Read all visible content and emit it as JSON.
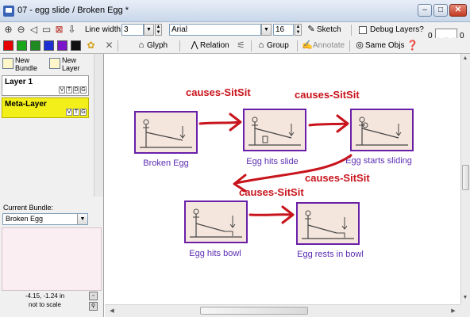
{
  "window": {
    "title": "07 - egg slide / Broken Egg *",
    "buttons": {
      "minimize": "–",
      "maximize": "□",
      "close": "✕"
    }
  },
  "toolbar1": {
    "line_width_label": "Line width:",
    "line_width_value": "3",
    "font_value": "Arial",
    "font_size_value": "16",
    "sketch_label": "Sketch",
    "debug_layers_label": "Debug Layers?",
    "scale_left": "0",
    "scale_right": "0"
  },
  "toolbar2": {
    "glyph_label": "Glyph",
    "relation_label": "Relation",
    "group_label": "Group",
    "annotate_label": "Annotate",
    "same_objs_label": "Same Objs",
    "swatch_colors": [
      "#e60000",
      "#1aa81a",
      "#1f8a1f",
      "#1c2fd4",
      "#7a15c9",
      "#111111"
    ]
  },
  "left_panel": {
    "new_bundle_line1": "New",
    "new_bundle_line2": "Bundle",
    "new_layer_line1": "New",
    "new_layer_line2": "Layer",
    "layers": [
      {
        "name": "Layer 1",
        "flags": [
          "V",
          "T",
          "D",
          "G"
        ]
      },
      {
        "name": "Meta-Layer",
        "flags": [
          "V",
          "T",
          "G"
        ]
      }
    ],
    "current_bundle_label": "Current Bundle:",
    "current_bundle_value": "Broken Egg",
    "coords": "-4.15, -1.24 in",
    "scale_note": "not to scale"
  },
  "canvas": {
    "relation_label": "causes-SitSit",
    "frames": [
      {
        "label": "Broken Egg"
      },
      {
        "label": "Egg hits slide"
      },
      {
        "label": "Egg starts sliding"
      },
      {
        "label": "Egg hits bowl"
      },
      {
        "label": "Egg rests in bowl"
      }
    ],
    "colors": {
      "arrow": "#c8141c",
      "frame_border": "#6a1fa8",
      "frame_fill": "#f5e6dd",
      "label": "#5b2db3"
    }
  }
}
